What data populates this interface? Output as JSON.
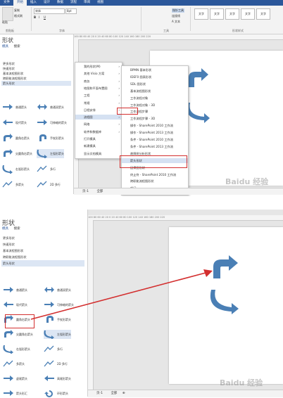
{
  "ribbon": {
    "tabs": [
      "文件",
      "开始",
      "插入",
      "设计",
      "数据",
      "流程",
      "审阅",
      "视图"
    ],
    "clipboard": {
      "paste": "粘贴",
      "copy": "复制",
      "format_painter": "格式刷",
      "group": "剪贴板"
    },
    "font": {
      "name": "宋体",
      "size": "8pt",
      "bold": "B",
      "italic": "I",
      "underline": "U",
      "group": "字体"
    },
    "tools": {
      "pointer": "指针工具",
      "connector": "连接线",
      "text": "A 文本",
      "group": "工具"
    },
    "shape_styles": {
      "group": "形状样式",
      "swatch": "文字"
    }
  },
  "top": {
    "pane": {
      "title": "形状",
      "tabs": [
        "模具",
        "搜索"
      ],
      "categories": [
        "更多形状",
        "快速形状",
        "基本流程图形状",
        "跨职能流程图形状",
        "箭头形状"
      ],
      "shapes": [
        {
          "left": "普通箭头",
          "right": "普通双箭头"
        },
        {
          "left": "现代箭头",
          "right": "可伸缩的箭头"
        },
        {
          "left": "圆角右箭头",
          "right": "手杖形箭头"
        },
        {
          "left": "尖圆角右箭头",
          "right": "左弧形箭头"
        },
        {
          "left": "右弧形箭头",
          "right": "多行"
        },
        {
          "left": "多箭头",
          "right": "2D 多行"
        },
        {
          "left": "虚尾箭头",
          "right": "高尾形箭头"
        },
        {
          "left": "箭头形汇",
          "right": "环形箭头"
        }
      ]
    },
    "menu1": {
      "items": [
        "我的形状(M)",
        "其他 Visio 方案",
        "商务",
        "地图和平面布置图",
        "工程",
        "常规",
        "日程安排",
        "流程图",
        "网络",
        "软件和数据库",
        "打开模具",
        "新建模具",
        "显示文档模具"
      ],
      "highlight": "流程图"
    },
    "menu2": {
      "items": [
        "BPMN 基本形状",
        "IDEF0 图表形状",
        "SDL 图形状",
        "基本流程图形状",
        "工作流程对象",
        "工作流程对象 - 3D",
        "工作流程步骤",
        "工作流程步骤 - 3D",
        "操作 - SharePoint 2010 工作流",
        "操作 - SharePoint 2013 工作流",
        "条件 - SharePoint 2010 工作流",
        "条件 - SharePoint 2013 工作流",
        "故障树分析形状",
        "箭头形状",
        "因果图形状",
        "终止符 - SharePoint 2010 工作流",
        "跨职能流程图形状",
        "部门"
      ],
      "highlight": "箭头形状"
    },
    "ruler": "100  80  60  40  20  0  20  40  60  80  100  120  140  160  180  200  220",
    "status": {
      "page": "页-1",
      "all": "全部",
      "add": "⊕"
    }
  },
  "bottom": {
    "pane": {
      "title": "形状",
      "tabs": [
        "模具",
        "搜索"
      ],
      "categories": [
        "更多形状",
        "快速形状",
        "基本流程图形状",
        "跨职能流程图形状",
        "箭头形状"
      ],
      "shapes": [
        {
          "left": "普通箭头",
          "right": "普通双箭头"
        },
        {
          "left": "现代箭头",
          "right": "可伸缩的箭头"
        },
        {
          "left": "圆角右箭头",
          "right": "手杖形箭头"
        },
        {
          "left": "尖圆角右箭头",
          "right": "左弧形箭头"
        },
        {
          "left": "右弧形箭头",
          "right": "多行"
        },
        {
          "left": "多箭头",
          "right": "2D 多行"
        },
        {
          "left": "虚尾箭头",
          "right": "高尾形箭头"
        },
        {
          "left": "箭头形汇",
          "right": "环形箭头"
        }
      ]
    },
    "ruler": "100  80  60  40  20  0  20  40  60  80  100  120  140  160  180  200  220",
    "status": {
      "page": "页-1",
      "all": "全部",
      "add": "⊕"
    }
  },
  "watermark": "Baidu 经验",
  "colors": {
    "ribbon_blue": "#2b579a",
    "arrow_blue": "#4a7fb5",
    "highlight_red": "#d32f2f",
    "selection": "#dce6f4"
  }
}
